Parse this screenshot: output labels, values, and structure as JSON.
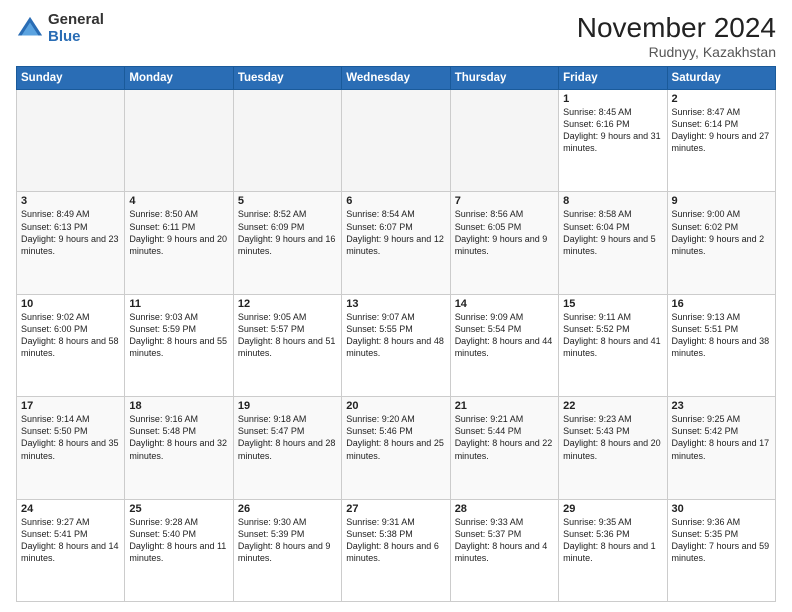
{
  "header": {
    "logo_general": "General",
    "logo_blue": "Blue",
    "main_title": "November 2024",
    "subtitle": "Rudnyy, Kazakhstan"
  },
  "weekdays": [
    "Sunday",
    "Monday",
    "Tuesday",
    "Wednesday",
    "Thursday",
    "Friday",
    "Saturday"
  ],
  "weeks": [
    [
      {
        "day": "",
        "info": ""
      },
      {
        "day": "",
        "info": ""
      },
      {
        "day": "",
        "info": ""
      },
      {
        "day": "",
        "info": ""
      },
      {
        "day": "",
        "info": ""
      },
      {
        "day": "1",
        "info": "Sunrise: 8:45 AM\nSunset: 6:16 PM\nDaylight: 9 hours\nand 31 minutes."
      },
      {
        "day": "2",
        "info": "Sunrise: 8:47 AM\nSunset: 6:14 PM\nDaylight: 9 hours\nand 27 minutes."
      }
    ],
    [
      {
        "day": "3",
        "info": "Sunrise: 8:49 AM\nSunset: 6:13 PM\nDaylight: 9 hours\nand 23 minutes."
      },
      {
        "day": "4",
        "info": "Sunrise: 8:50 AM\nSunset: 6:11 PM\nDaylight: 9 hours\nand 20 minutes."
      },
      {
        "day": "5",
        "info": "Sunrise: 8:52 AM\nSunset: 6:09 PM\nDaylight: 9 hours\nand 16 minutes."
      },
      {
        "day": "6",
        "info": "Sunrise: 8:54 AM\nSunset: 6:07 PM\nDaylight: 9 hours\nand 12 minutes."
      },
      {
        "day": "7",
        "info": "Sunrise: 8:56 AM\nSunset: 6:05 PM\nDaylight: 9 hours\nand 9 minutes."
      },
      {
        "day": "8",
        "info": "Sunrise: 8:58 AM\nSunset: 6:04 PM\nDaylight: 9 hours\nand 5 minutes."
      },
      {
        "day": "9",
        "info": "Sunrise: 9:00 AM\nSunset: 6:02 PM\nDaylight: 9 hours\nand 2 minutes."
      }
    ],
    [
      {
        "day": "10",
        "info": "Sunrise: 9:02 AM\nSunset: 6:00 PM\nDaylight: 8 hours\nand 58 minutes."
      },
      {
        "day": "11",
        "info": "Sunrise: 9:03 AM\nSunset: 5:59 PM\nDaylight: 8 hours\nand 55 minutes."
      },
      {
        "day": "12",
        "info": "Sunrise: 9:05 AM\nSunset: 5:57 PM\nDaylight: 8 hours\nand 51 minutes."
      },
      {
        "day": "13",
        "info": "Sunrise: 9:07 AM\nSunset: 5:55 PM\nDaylight: 8 hours\nand 48 minutes."
      },
      {
        "day": "14",
        "info": "Sunrise: 9:09 AM\nSunset: 5:54 PM\nDaylight: 8 hours\nand 44 minutes."
      },
      {
        "day": "15",
        "info": "Sunrise: 9:11 AM\nSunset: 5:52 PM\nDaylight: 8 hours\nand 41 minutes."
      },
      {
        "day": "16",
        "info": "Sunrise: 9:13 AM\nSunset: 5:51 PM\nDaylight: 8 hours\nand 38 minutes."
      }
    ],
    [
      {
        "day": "17",
        "info": "Sunrise: 9:14 AM\nSunset: 5:50 PM\nDaylight: 8 hours\nand 35 minutes."
      },
      {
        "day": "18",
        "info": "Sunrise: 9:16 AM\nSunset: 5:48 PM\nDaylight: 8 hours\nand 32 minutes."
      },
      {
        "day": "19",
        "info": "Sunrise: 9:18 AM\nSunset: 5:47 PM\nDaylight: 8 hours\nand 28 minutes."
      },
      {
        "day": "20",
        "info": "Sunrise: 9:20 AM\nSunset: 5:46 PM\nDaylight: 8 hours\nand 25 minutes."
      },
      {
        "day": "21",
        "info": "Sunrise: 9:21 AM\nSunset: 5:44 PM\nDaylight: 8 hours\nand 22 minutes."
      },
      {
        "day": "22",
        "info": "Sunrise: 9:23 AM\nSunset: 5:43 PM\nDaylight: 8 hours\nand 20 minutes."
      },
      {
        "day": "23",
        "info": "Sunrise: 9:25 AM\nSunset: 5:42 PM\nDaylight: 8 hours\nand 17 minutes."
      }
    ],
    [
      {
        "day": "24",
        "info": "Sunrise: 9:27 AM\nSunset: 5:41 PM\nDaylight: 8 hours\nand 14 minutes."
      },
      {
        "day": "25",
        "info": "Sunrise: 9:28 AM\nSunset: 5:40 PM\nDaylight: 8 hours\nand 11 minutes."
      },
      {
        "day": "26",
        "info": "Sunrise: 9:30 AM\nSunset: 5:39 PM\nDaylight: 8 hours\nand 9 minutes."
      },
      {
        "day": "27",
        "info": "Sunrise: 9:31 AM\nSunset: 5:38 PM\nDaylight: 8 hours\nand 6 minutes."
      },
      {
        "day": "28",
        "info": "Sunrise: 9:33 AM\nSunset: 5:37 PM\nDaylight: 8 hours\nand 4 minutes."
      },
      {
        "day": "29",
        "info": "Sunrise: 9:35 AM\nSunset: 5:36 PM\nDaylight: 8 hours\nand 1 minute."
      },
      {
        "day": "30",
        "info": "Sunrise: 9:36 AM\nSunset: 5:35 PM\nDaylight: 7 hours\nand 59 minutes."
      }
    ]
  ]
}
